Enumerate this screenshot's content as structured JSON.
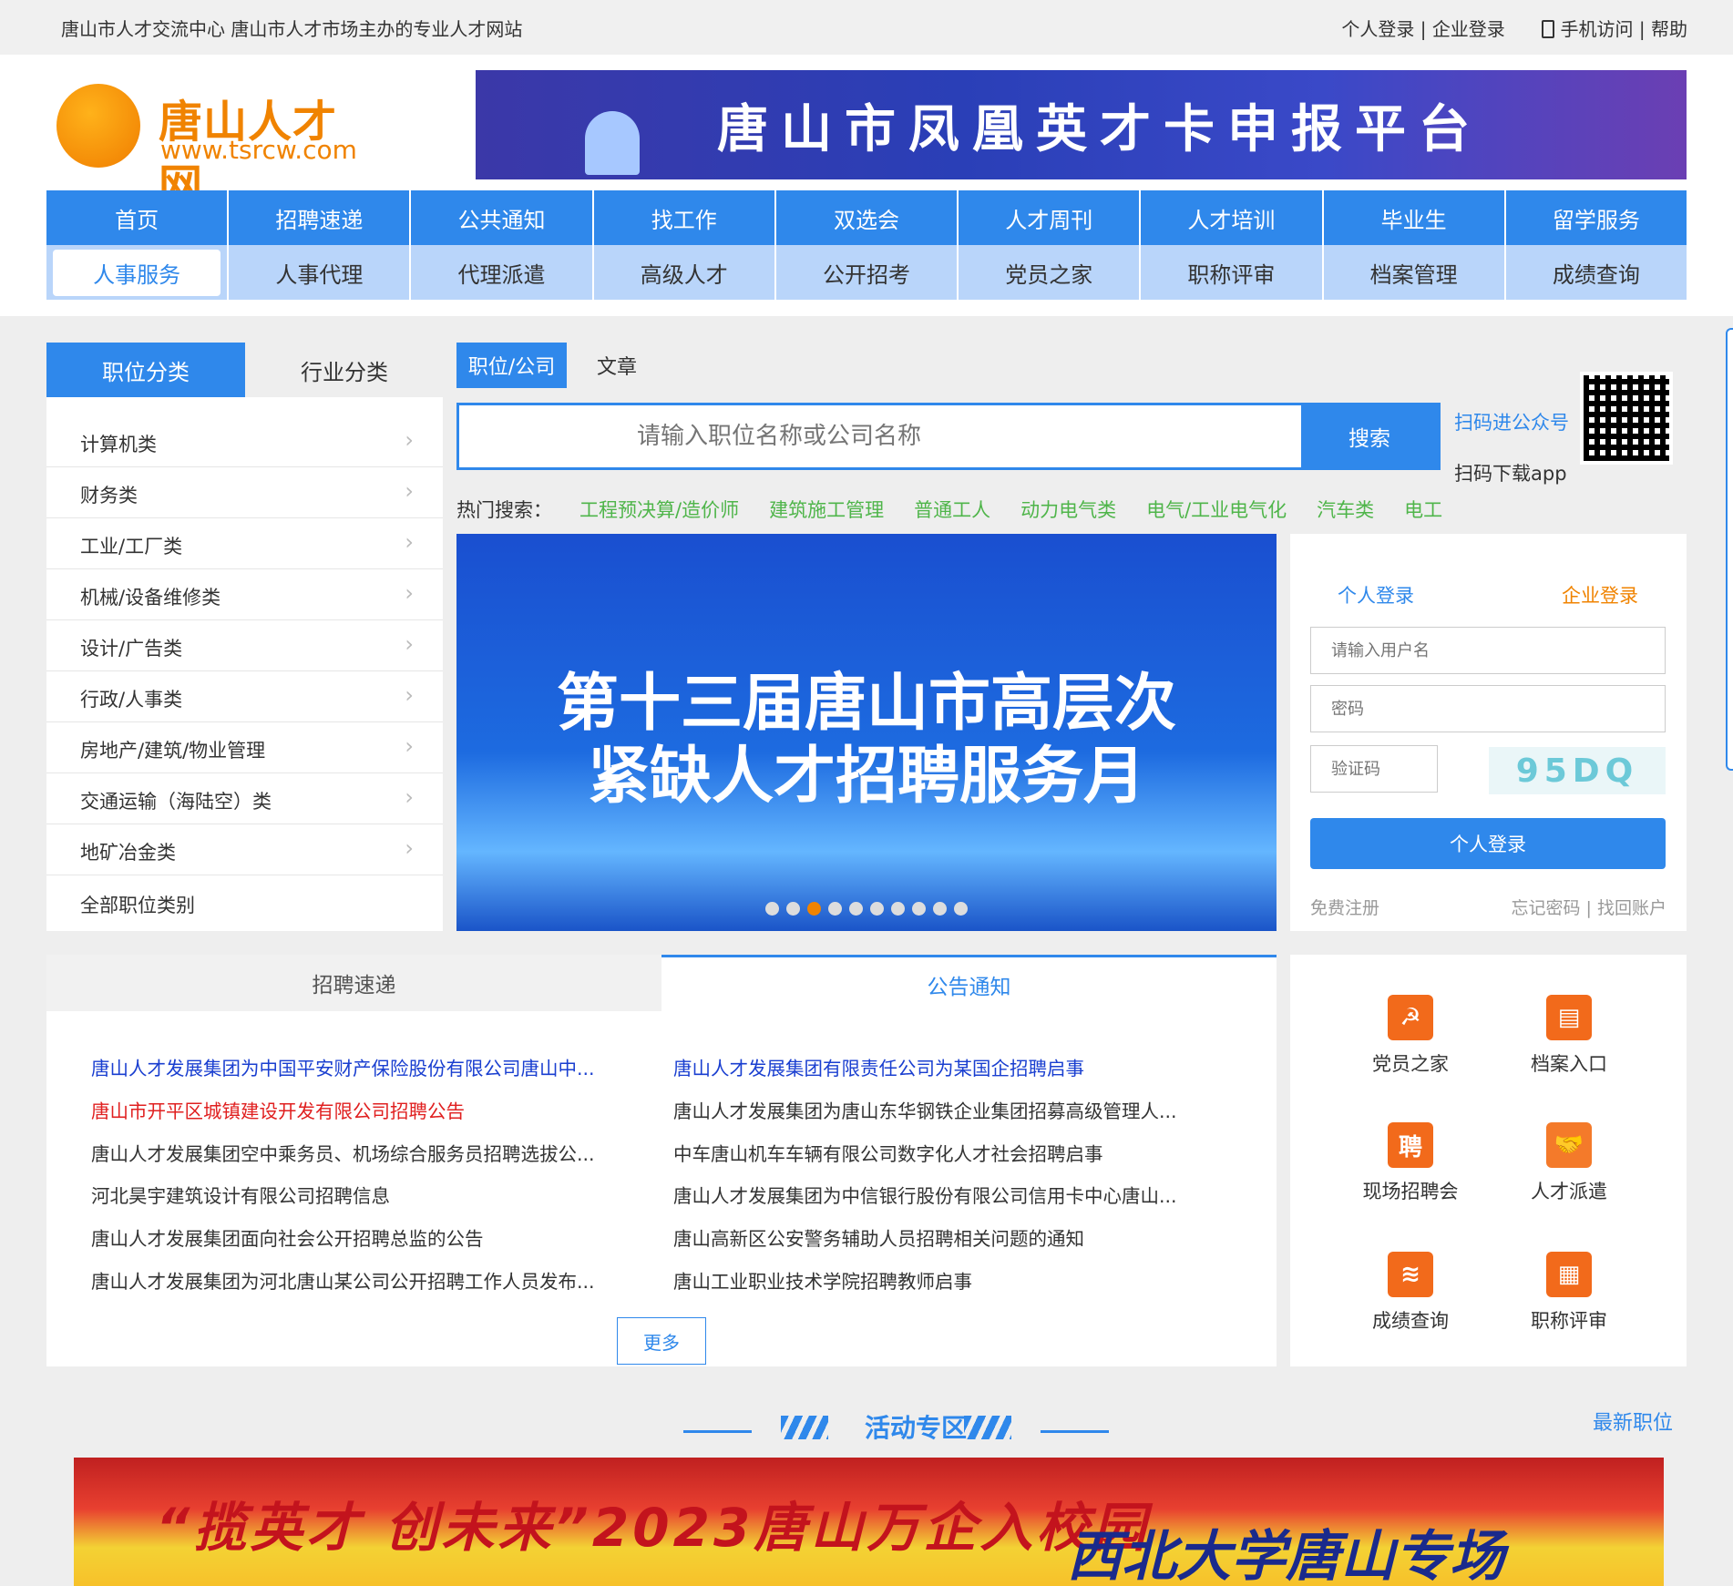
{
  "topbar": {
    "left_text": "唐山市人才交流中心  唐山市人才市场主办的专业人才网站",
    "personal_login": "个人登录",
    "company_login": "企业登录",
    "sep": "|",
    "mobile": "手机访问",
    "help": "帮助"
  },
  "logo": {
    "name": "唐山人才网",
    "url": "www.tsrcw.com"
  },
  "banner": {
    "text": "唐山市凤凰英才卡申报平台"
  },
  "nav1": [
    "首页",
    "招聘速递",
    "公共通知",
    "找工作",
    "双选会",
    "人才周刊",
    "人才培训",
    "毕业生",
    "留学服务"
  ],
  "nav2": [
    "人事服务",
    "人事代理",
    "代理派遣",
    "高级人才",
    "公开招考",
    "党员之家",
    "职称评审",
    "档案管理",
    "成绩查询"
  ],
  "left_tabs": {
    "active": "职位分类",
    "other": "行业分类"
  },
  "categories": [
    "计算机类",
    "财务类",
    "工业/工厂类",
    "机械/设备维修类",
    "设计/广告类",
    "行政/人事类",
    "房地产/建筑/物业管理",
    "交通运输（海陆空）类",
    "地矿冶金类",
    "全部职位类别"
  ],
  "search": {
    "tab_active": "职位/公司",
    "tab_other": "文章",
    "placeholder": "请输入职位名称或公司名称",
    "button": "搜索",
    "qr_text1": "扫码进公众号",
    "qr_text2": "扫码下载app",
    "hot_label": "热门搜索：",
    "hot": [
      "工程预决算/造价师",
      "建筑施工管理",
      "普通工人",
      "动力电气类",
      "电气/工业电气化",
      "汽车类",
      "电工"
    ]
  },
  "carousel": {
    "line1": "第十三届唐山市高层次",
    "line2": "紧缺人才招聘服务月",
    "active_dot": 3
  },
  "login": {
    "tab_personal": "个人登录",
    "tab_company": "企业登录",
    "username_ph": "请输入用户名",
    "password_ph": "密码",
    "captcha_ph": "验证码",
    "captcha": "95DQ",
    "button": "个人登录",
    "register": "免费注册",
    "forgot": "忘记密码 | 找回账户"
  },
  "news": {
    "tab1": "招聘速递",
    "tab2": "公告通知",
    "left": [
      "唐山人才发展集团为中国平安财产保险股份有限公司唐山中...",
      "唐山市开平区城镇建设开发有限公司招聘公告",
      "唐山人才发展集团空中乘务员、机场综合服务员招聘选拔公...",
      "河北昊宇建筑设计有限公司招聘信息",
      "唐山人才发展集团面向社会公开招聘总监的公告",
      "唐山人才发展集团为河北唐山某公司公开招聘工作人员发布..."
    ],
    "right": [
      "唐山人才发展集团有限责任公司为某国企招聘启事",
      "唐山人才发展集团为唐山东华钢铁企业集团招募高级管理人...",
      "中车唐山机车车辆有限公司数字化人才社会招聘启事",
      "唐山人才发展集团为中信银行股份有限公司信用卡中心唐山...",
      "唐山高新区公安警务辅助人员招聘相关问题的通知",
      "唐山工业职业技术学院招聘教师启事"
    ],
    "more": "更多",
    "left_colors": [
      "#1a3fd0",
      "#e02020",
      "#333333",
      "#333333",
      "#333333",
      "#333333"
    ],
    "right_colors": [
      "#1a3fd0",
      "#333333",
      "#333333",
      "#333333",
      "#333333",
      "#333333"
    ]
  },
  "quick": [
    {
      "label": "党员之家",
      "icon": "party-icon",
      "glyph": "☭"
    },
    {
      "label": "档案入口",
      "icon": "archive-icon",
      "glyph": "▤"
    },
    {
      "label": "现场招聘会",
      "icon": "job-fair-icon",
      "glyph": "聘"
    },
    {
      "label": "人才派遣",
      "icon": "handshake-icon",
      "glyph": "🤝"
    },
    {
      "label": "成绩查询",
      "icon": "score-search-icon",
      "glyph": "≋"
    },
    {
      "label": "职称评审",
      "icon": "title-review-icon",
      "glyph": "▦"
    }
  ],
  "activity": {
    "title": "活动专区",
    "latest": "最新职位",
    "banner_text1": "“揽英才 创未来”2023唐山万企入校园",
    "banner_text2": "西北大学唐山专场"
  },
  "colors": {
    "primary": "#2f88eb",
    "orange": "#f08300",
    "hot": "#4fb54a"
  }
}
